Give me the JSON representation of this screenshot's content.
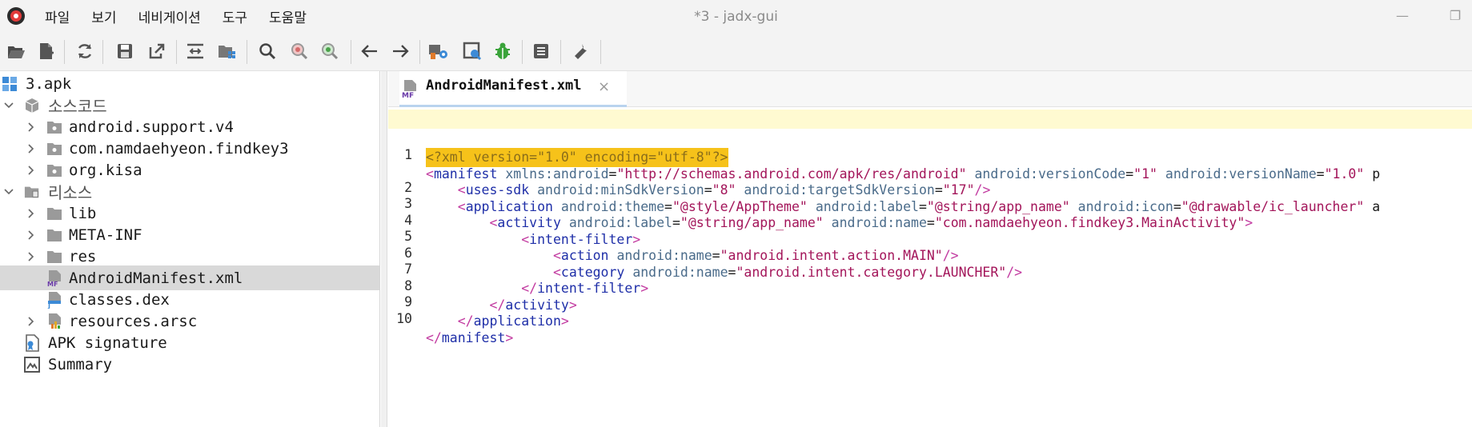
{
  "window": {
    "title": "*3 - jadx-gui",
    "minimize_glyph": "—",
    "restore_glyph": "❐"
  },
  "menu": {
    "items": [
      "파일",
      "보기",
      "네비게이션",
      "도구",
      "도움말"
    ]
  },
  "toolbar": {
    "buttons": [
      "open-file-icon",
      "add-files-icon",
      "reload-icon",
      "save-all-icon",
      "export-icon",
      "sync-tree-icon",
      "flatten-packages-icon",
      "search-icon",
      "find-class-icon",
      "find-usage-icon",
      "back-icon",
      "forward-icon",
      "deobfuscation-icon",
      "quark-icon",
      "debugger-icon",
      "log-viewer-icon",
      "preferences-icon"
    ]
  },
  "tree": {
    "root": "3.apk",
    "source_code": "소스코드",
    "packages": [
      "android.support.v4",
      "com.namdaehyeon.findkey3",
      "org.kisa"
    ],
    "resources": "리소스",
    "resource_items": [
      "lib",
      "META-INF",
      "res",
      "AndroidManifest.xml",
      "classes.dex",
      "resources.arsc"
    ],
    "apk_signature": "APK signature",
    "summary": "Summary",
    "selected": "AndroidManifest.xml"
  },
  "editor": {
    "tab_label": "AndroidManifest.xml",
    "tab_icon_text": "MF",
    "tab_close": "×",
    "line_numbers": [
      "",
      "1",
      "",
      "2",
      "3",
      "4",
      "5",
      "6",
      "7",
      "8",
      "9",
      "10"
    ],
    "lines": [
      "<?xml version=\"1.0\" encoding=\"utf-8\"?>",
      "<manifest xmlns:android=\"http://schemas.android.com/apk/res/android\" android:versionCode=\"1\" android:versionName=\"1.0\" p",
      "    <uses-sdk android:minSdkVersion=\"8\" android:targetSdkVersion=\"17\"/>",
      "    <application android:theme=\"@style/AppTheme\" android:label=\"@string/app_name\" android:icon=\"@drawable/ic_launcher\" a",
      "        <activity android:label=\"@string/app_name\" android:name=\"com.namdaehyeon.findkey3.MainActivity\">",
      "            <intent-filter>",
      "                <action android:name=\"android.intent.action.MAIN\"/>",
      "                <category android:name=\"android.intent.category.LAUNCHER\"/>",
      "            </intent-filter>",
      "        </activity>",
      "    </application>",
      "</manifest>"
    ]
  },
  "colors": {
    "tag": "#1f2fa8",
    "attribute": "#4a6b8a",
    "value": "#a3155a",
    "punctuation": "#c23aa0",
    "xml_decl_bg": "#f6c21a",
    "current_line": "#fffad1",
    "selection": "#d9d9d9"
  }
}
